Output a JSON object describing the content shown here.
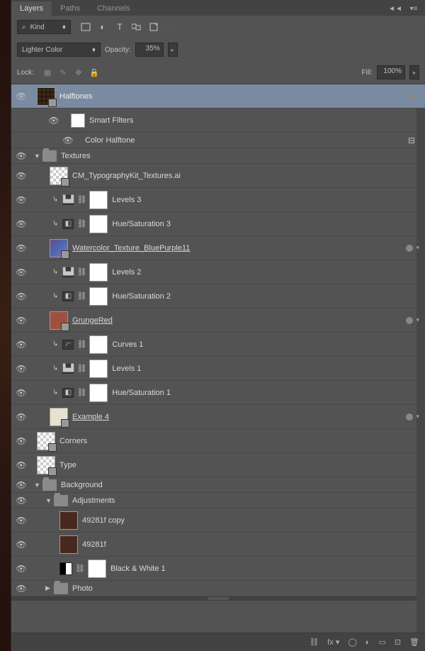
{
  "tabs": {
    "layers": "Layers",
    "paths": "Paths",
    "channels": "Channels"
  },
  "kind": {
    "label": "Kind"
  },
  "blend": {
    "mode": "Lighter Color",
    "opacity_label": "Opacity:",
    "opacity_value": "35%"
  },
  "lock": {
    "label": "Lock:",
    "fill_label": "Fill:",
    "fill_value": "100%"
  },
  "layers": {
    "halftones": "Halftones",
    "smart_filters": "Smart Filters",
    "color_halftone": "Color Halftone",
    "textures": "Textures",
    "cm_typo": "CM_TypographyKit_Textures.ai",
    "levels3": "Levels 3",
    "huesat3": "Hue/Saturation 3",
    "watercolor": "  Watercolor_Texture_BluePurple11  ",
    "levels2": "Levels 2",
    "huesat2": "Hue/Saturation 2",
    "grungered": "  GrungeRed  ",
    "curves1": "Curves 1",
    "levels1": "Levels 1",
    "huesat1": "Hue/Saturation 1",
    "example4": "  Example 4  ",
    "corners": "Corners",
    "type": "Type",
    "background": "Background",
    "adjustments": "Adjustments",
    "copy49": "49281f copy",
    "orig49": "49281f",
    "bw1": "Black & White 1",
    "photo": "Photo"
  }
}
